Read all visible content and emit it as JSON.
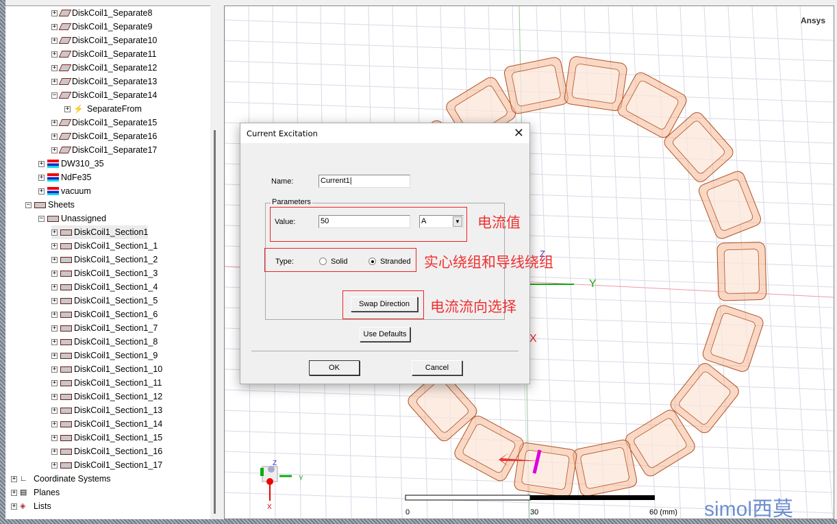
{
  "tree": {
    "items": [
      {
        "label": "DiskCoil1_Separate8",
        "icon": "solid-icon",
        "level": 3,
        "expander": "+"
      },
      {
        "label": "DiskCoil1_Separate9",
        "icon": "solid-icon",
        "level": 3,
        "expander": "+"
      },
      {
        "label": "DiskCoil1_Separate10",
        "icon": "solid-icon",
        "level": 3,
        "expander": "+"
      },
      {
        "label": "DiskCoil1_Separate11",
        "icon": "solid-icon",
        "level": 3,
        "expander": "+"
      },
      {
        "label": "DiskCoil1_Separate12",
        "icon": "solid-icon",
        "level": 3,
        "expander": "+"
      },
      {
        "label": "DiskCoil1_Separate13",
        "icon": "solid-icon",
        "level": 3,
        "expander": "+"
      },
      {
        "label": "DiskCoil1_Separate14",
        "icon": "solid-icon",
        "level": 3,
        "expander": "-"
      },
      {
        "label": "SeparateFrom",
        "icon": "operation-icon",
        "level": 4,
        "expander": "+"
      },
      {
        "label": "DiskCoil1_Separate15",
        "icon": "solid-icon",
        "level": 3,
        "expander": "+"
      },
      {
        "label": "DiskCoil1_Separate16",
        "icon": "solid-icon",
        "level": 3,
        "expander": "+"
      },
      {
        "label": "DiskCoil1_Separate17",
        "icon": "solid-icon",
        "level": 3,
        "expander": "+"
      },
      {
        "label": "DW310_35",
        "icon": "material-icon",
        "level": 2,
        "expander": "+"
      },
      {
        "label": "NdFe35",
        "icon": "material-icon",
        "level": 2,
        "expander": "+"
      },
      {
        "label": "vacuum",
        "icon": "material-icon",
        "level": 2,
        "expander": "+"
      },
      {
        "label": "Sheets",
        "icon": "sheet-icon",
        "level": 1,
        "expander": "-"
      },
      {
        "label": "Unassigned",
        "icon": "sheet-icon",
        "level": 2,
        "expander": "-"
      },
      {
        "label": "DiskCoil1_Section1",
        "icon": "sheet-icon",
        "level": 3,
        "expander": "+",
        "selected": true
      },
      {
        "label": "DiskCoil1_Section1_1",
        "icon": "sheet-icon",
        "level": 3,
        "expander": "+"
      },
      {
        "label": "DiskCoil1_Section1_2",
        "icon": "sheet-icon",
        "level": 3,
        "expander": "+"
      },
      {
        "label": "DiskCoil1_Section1_3",
        "icon": "sheet-icon",
        "level": 3,
        "expander": "+"
      },
      {
        "label": "DiskCoil1_Section1_4",
        "icon": "sheet-icon",
        "level": 3,
        "expander": "+"
      },
      {
        "label": "DiskCoil1_Section1_5",
        "icon": "sheet-icon",
        "level": 3,
        "expander": "+"
      },
      {
        "label": "DiskCoil1_Section1_6",
        "icon": "sheet-icon",
        "level": 3,
        "expander": "+"
      },
      {
        "label": "DiskCoil1_Section1_7",
        "icon": "sheet-icon",
        "level": 3,
        "expander": "+"
      },
      {
        "label": "DiskCoil1_Section1_8",
        "icon": "sheet-icon",
        "level": 3,
        "expander": "+"
      },
      {
        "label": "DiskCoil1_Section1_9",
        "icon": "sheet-icon",
        "level": 3,
        "expander": "+"
      },
      {
        "label": "DiskCoil1_Section1_10",
        "icon": "sheet-icon",
        "level": 3,
        "expander": "+"
      },
      {
        "label": "DiskCoil1_Section1_11",
        "icon": "sheet-icon",
        "level": 3,
        "expander": "+"
      },
      {
        "label": "DiskCoil1_Section1_12",
        "icon": "sheet-icon",
        "level": 3,
        "expander": "+"
      },
      {
        "label": "DiskCoil1_Section1_13",
        "icon": "sheet-icon",
        "level": 3,
        "expander": "+"
      },
      {
        "label": "DiskCoil1_Section1_14",
        "icon": "sheet-icon",
        "level": 3,
        "expander": "+"
      },
      {
        "label": "DiskCoil1_Section1_15",
        "icon": "sheet-icon",
        "level": 3,
        "expander": "+"
      },
      {
        "label": "DiskCoil1_Section1_16",
        "icon": "sheet-icon",
        "level": 3,
        "expander": "+"
      },
      {
        "label": "DiskCoil1_Section1_17",
        "icon": "sheet-icon",
        "level": 3,
        "expander": "+"
      },
      {
        "label": "Coordinate Systems",
        "icon": "coordinate-icon",
        "level": 0,
        "expander": "+"
      },
      {
        "label": "Planes",
        "icon": "planes-icon",
        "level": 0,
        "expander": "+"
      },
      {
        "label": "Lists",
        "icon": "lists-icon",
        "level": 0,
        "expander": "+"
      }
    ]
  },
  "viewport": {
    "brand": "Ansys",
    "axes": {
      "x": "X",
      "y": "Y",
      "z": "Z"
    },
    "scale": {
      "ticks": [
        "0",
        "30",
        "60 (mm)"
      ]
    },
    "watermark": "simol西莫",
    "coil_color": "#f4b896"
  },
  "dialog": {
    "title": "Current Excitation",
    "name_label": "Name:",
    "name_value": "Current1",
    "group_label": "Parameters",
    "value_label": "Value:",
    "value": "50",
    "unit": "A",
    "type_label": "Type:",
    "type_options": [
      "Solid",
      "Stranded"
    ],
    "type_selected": "Stranded",
    "swap_button": "Swap Direction",
    "defaults_button": "Use Defaults",
    "ok_button": "OK",
    "cancel_button": "Cancel"
  },
  "annotations": {
    "value_note": "电流值",
    "type_note": "实心绕组和导线绕组",
    "direction_note": "电流流向选择"
  }
}
